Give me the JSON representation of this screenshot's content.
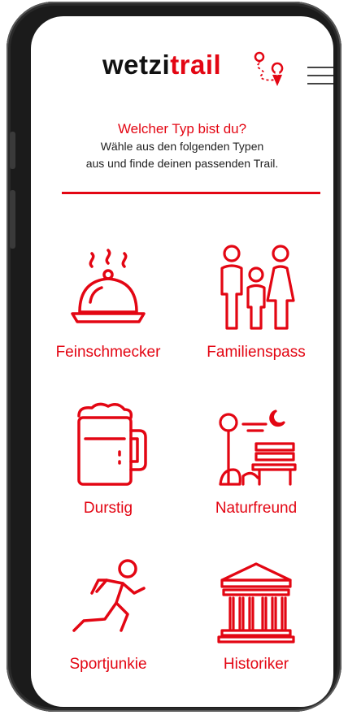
{
  "header": {
    "logo_part1": "wetzi",
    "logo_part2": "trail",
    "logo_icon": "route-pin-icon",
    "menu_icon": "hamburger-menu-icon"
  },
  "intro": {
    "title": "Welcher Typ bist du?",
    "line1": "Wähle aus den folgenden Typen",
    "line2": "aus und finde deinen passenden Trail."
  },
  "types": [
    {
      "label": "Feinschmecker",
      "icon": "cloche-icon"
    },
    {
      "label": "Familienspass",
      "icon": "family-icon"
    },
    {
      "label": "Durstig",
      "icon": "beer-mug-icon"
    },
    {
      "label": "Naturfreund",
      "icon": "park-bench-icon"
    },
    {
      "label": "Sportjunkie",
      "icon": "runner-icon"
    },
    {
      "label": "Historiker",
      "icon": "temple-icon"
    }
  ],
  "colors": {
    "accent": "#e30613",
    "text": "#111111"
  }
}
